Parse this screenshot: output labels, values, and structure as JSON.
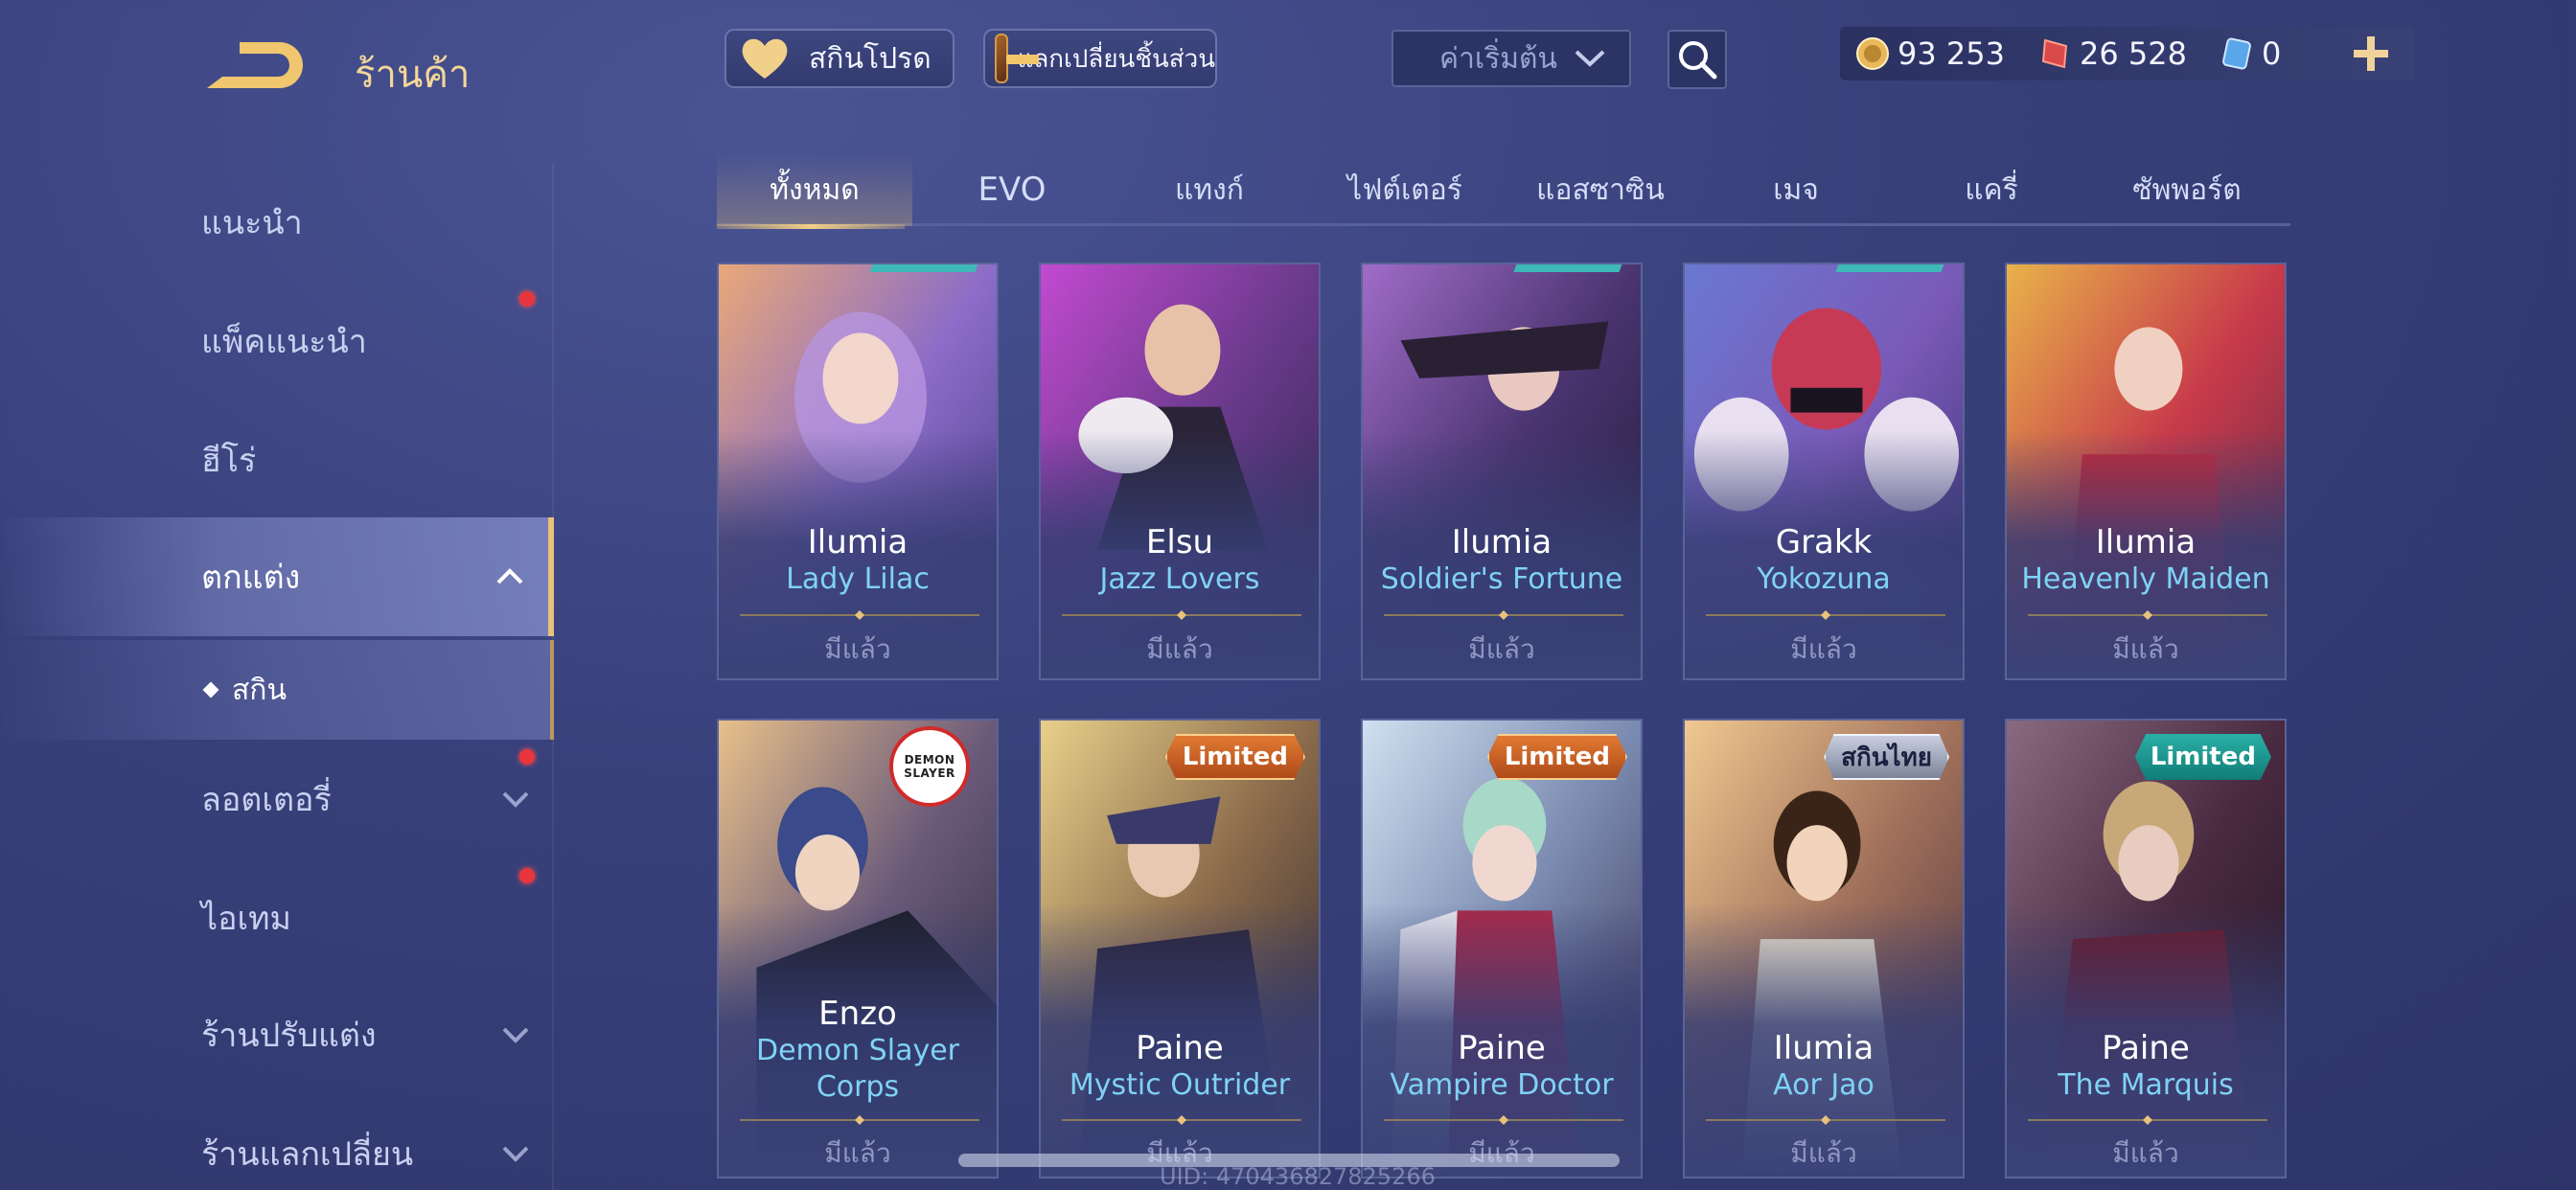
{
  "header": {
    "title": "ร้านค้า",
    "favorite_label": "สกินโปรด",
    "exchange_label": "แลกเปลี่ยนชิ้นส่วน",
    "sort_label": "ค่าเริ่มต้น"
  },
  "currency": [
    {
      "icon": "gold-coin-icon",
      "value": "93 253"
    },
    {
      "icon": "voucher-icon",
      "value": "26 528"
    },
    {
      "icon": "ticket-icon",
      "value": "0"
    }
  ],
  "sidebar": {
    "items": [
      {
        "label": "แนะนำ"
      },
      {
        "label": "แพ็คแนะนำ"
      },
      {
        "label": "ฮีโร่"
      },
      {
        "label": "ตกแต่ง"
      },
      {
        "label": "สกิน"
      },
      {
        "label": "ลอตเตอรี่"
      },
      {
        "label": "ไอเทม"
      },
      {
        "label": "ร้านปรับแต่ง"
      },
      {
        "label": "ร้านแลกเปลี่ยน"
      }
    ]
  },
  "tabs": [
    "ทั้งหมด",
    "EVO",
    "แทงก์",
    "ไฟต์เตอร์",
    "แอสซาซิน",
    "เมจ",
    "แครี่",
    "ซัพพอร์ต"
  ],
  "owned_label": "มีแล้ว",
  "cards": [
    {
      "hero": "Ilumia",
      "skin": "Lady Lilac"
    },
    {
      "hero": "Elsu",
      "skin": "Jazz Lovers"
    },
    {
      "hero": "Ilumia",
      "skin": "Soldier's Fortune"
    },
    {
      "hero": "Grakk",
      "skin": "Yokozuna"
    },
    {
      "hero": "Ilumia",
      "skin": "Heavenly Maiden"
    },
    {
      "hero": "Enzo",
      "skin": "Demon Slayer Corps",
      "logo": "DEMON SLAYER"
    },
    {
      "hero": "Paine",
      "skin": "Mystic Outrider",
      "tag": "Limited"
    },
    {
      "hero": "Paine",
      "skin": "Vampire Doctor",
      "tag": "Limited"
    },
    {
      "hero": "Ilumia",
      "skin": "Aor Jao",
      "tag": "สกินไทย"
    },
    {
      "hero": "Paine",
      "skin": "The Marquis",
      "tag": "Limited"
    }
  ],
  "footer": {
    "uid": "UID: 470436827825266"
  },
  "colors": {
    "accent_gold": "#f2d79a",
    "skin_name": "#7fd2f5",
    "notify_red": "#e8343c"
  }
}
